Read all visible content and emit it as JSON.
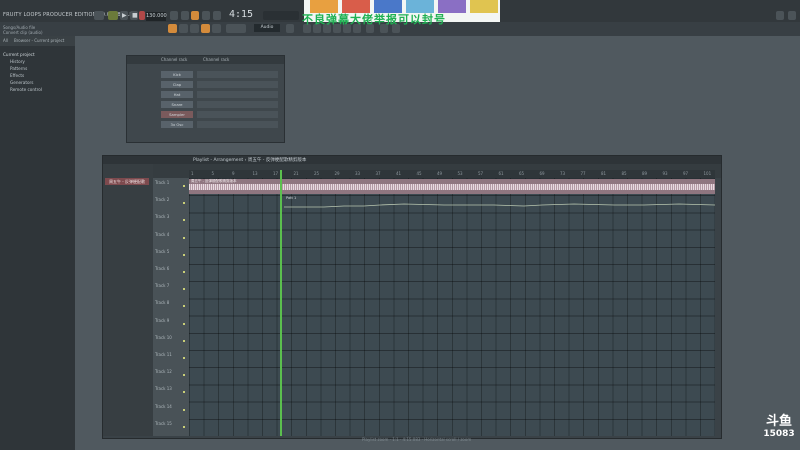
{
  "app": {
    "title": "FRUITY LOOPS PRODUCER EDITION 20.0.3 BUILD",
    "hint_line1": "Songs/Audio file",
    "hint_line2": "Convert clip (audio)",
    "clock": "4:15",
    "tempo": "130.000",
    "pattern": "Audio"
  },
  "overlay": {
    "text": "不良弹幕大佬举报可以封号"
  },
  "browser": {
    "tabs": [
      "All",
      "Browser - Current project"
    ],
    "items": [
      {
        "label": "Current project",
        "type": "cat"
      },
      {
        "label": "History",
        "type": "item"
      },
      {
        "label": "Patterns",
        "type": "item"
      },
      {
        "label": "Effects",
        "type": "item"
      },
      {
        "label": "Generators",
        "type": "item"
      },
      {
        "label": "Remote control",
        "type": "item"
      }
    ]
  },
  "channel_rack": {
    "title": "Channel rack",
    "filter": "Channel rack",
    "channels": [
      {
        "name": "Kick",
        "selected": false
      },
      {
        "name": "Clap",
        "selected": false
      },
      {
        "name": "Hat",
        "selected": false
      },
      {
        "name": "Snare",
        "selected": false
      },
      {
        "name": "Sampler",
        "selected": true
      },
      {
        "name": "3x Osc",
        "selected": false
      }
    ]
  },
  "playlist": {
    "title": "Playlist - Arrangement › 周五午 - 反弹梗配歌精剪版本",
    "pattern_select": "周五午 - 反弹梗配歌",
    "audio_clip_label": "周五午 - 反弹梗配歌精剪版本",
    "automation_label": "Patt 1",
    "tracks": [
      "Track 1",
      "Track 2",
      "Track 3",
      "Track 4",
      "Track 5",
      "Track 6",
      "Track 7",
      "Track 8",
      "Track 9",
      "Track 10",
      "Track 11",
      "Track 12",
      "Track 13",
      "Track 14",
      "Track 15"
    ],
    "ruler": [
      "1",
      "5",
      "9",
      "13",
      "17",
      "21",
      "25",
      "29",
      "33",
      "37",
      "41",
      "45",
      "49",
      "53",
      "57",
      "61",
      "65",
      "69",
      "73",
      "77",
      "81",
      "85",
      "89",
      "93",
      "97",
      "101"
    ]
  },
  "status": {
    "text": "Playlist zoom · 1:1 · 4:15:083 · Horizontal scroll / zoom"
  },
  "watermark": {
    "logo": "斗鱼",
    "room": "15083"
  },
  "colors": {
    "accent": "#5bc04e",
    "overlay_text": "#1fb153",
    "pattern_red": "#7d4a4e"
  }
}
